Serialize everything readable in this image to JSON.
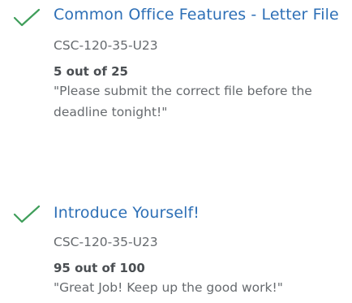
{
  "colors": {
    "accent": "#2d6fb6",
    "check": "#3f9e5a",
    "muted": "#666a6e"
  },
  "feed": {
    "items": [
      {
        "icon": "check-icon",
        "title": "Common Office Features - Letter File",
        "course": "CSC-120-35-U23",
        "score": "5 out of 25",
        "comment": "\"Please submit the correct file before the deadline tonight!\""
      },
      {
        "icon": "check-icon",
        "title": "Introduce Yourself!",
        "course": "CSC-120-35-U23",
        "score": "95 out of 100",
        "comment": "\"Great Job! Keep up the good work!\""
      }
    ]
  }
}
